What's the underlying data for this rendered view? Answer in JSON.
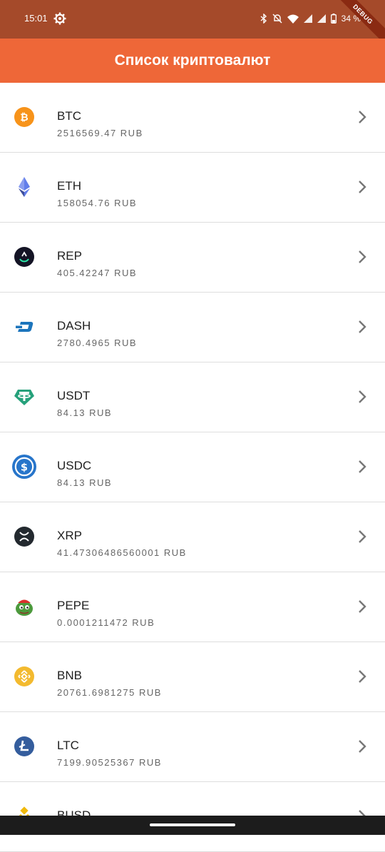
{
  "status": {
    "time": "15:01",
    "battery": "34 %",
    "debug": "DEBUG"
  },
  "appbar": {
    "title": "Список криптовалют"
  },
  "coins": [
    {
      "name": "BTC",
      "price": "2516569.47 RUB",
      "icon": "bitcoin-icon",
      "color": "#f7931a"
    },
    {
      "name": "ETH",
      "price": "158054.76 RUB",
      "icon": "ethereum-icon",
      "color": "#627eea"
    },
    {
      "name": "REP",
      "price": "405.42247 RUB",
      "icon": "augur-icon",
      "color": "#1a1a2e"
    },
    {
      "name": "DASH",
      "price": "2780.4965 RUB",
      "icon": "dash-icon",
      "color": "#1c75bc"
    },
    {
      "name": "USDT",
      "price": "84.13 RUB",
      "icon": "tether-icon",
      "color": "#26a17b"
    },
    {
      "name": "USDC",
      "price": "84.13 RUB",
      "icon": "usdc-icon",
      "color": "#2775ca"
    },
    {
      "name": "XRP",
      "price": "41.47306486560001 RUB",
      "icon": "xrp-icon",
      "color": "#23292f"
    },
    {
      "name": "PEPE",
      "price": "0.0001211472 RUB",
      "icon": "pepe-icon",
      "color": "#4c9a3d"
    },
    {
      "name": "BNB",
      "price": "20761.6981275 RUB",
      "icon": "bnb-icon",
      "color": "#f3ba2f"
    },
    {
      "name": "LTC",
      "price": "7199.90525367 RUB",
      "icon": "litecoin-icon",
      "color": "#345d9d"
    },
    {
      "name": "BUSD",
      "price": "",
      "icon": "busd-icon",
      "color": "#f0b90b"
    }
  ]
}
